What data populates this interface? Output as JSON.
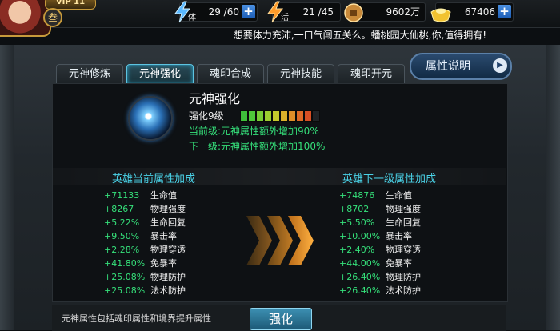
{
  "topbar": {
    "vip_label": "VIP 11",
    "rank_badge": "叁",
    "stamina": {
      "icon": "lightning-icon",
      "label": "体",
      "value": "29 /60"
    },
    "vitality": {
      "icon": "lightning-icon",
      "label": "活",
      "value": "21 /45"
    },
    "coins": {
      "icon": "coin-icon",
      "value": "9602万"
    },
    "gold": {
      "icon": "gold-ingot-icon",
      "value": "67406"
    }
  },
  "notice": "想要体力充沛,一口气闯五关么。蟠桃园大仙桃,你,值得拥有!",
  "tabs": [
    {
      "label": "元神修炼"
    },
    {
      "label": "元神强化",
      "active": true
    },
    {
      "label": "魂印合成"
    },
    {
      "label": "元神技能"
    },
    {
      "label": "魂印开元"
    }
  ],
  "info_button": "属性说明",
  "skill": {
    "title": "元神强化",
    "level_label": "强化9级",
    "level_current": 9,
    "level_max": 10,
    "current_bonus": "当前级:元神属性额外增加90%",
    "next_bonus": "下一级:元神属性额外增加100%"
  },
  "current_header": "英雄当前属性加成",
  "next_header": "英雄下一级属性加成",
  "current_attrs": [
    {
      "value": "+71133",
      "name": "生命值"
    },
    {
      "value": "+8267",
      "name": "物理强度"
    },
    {
      "value": "+5.22%",
      "name": "生命回复"
    },
    {
      "value": "+9.50%",
      "name": "暴击率"
    },
    {
      "value": "+2.28%",
      "name": "物理穿透"
    },
    {
      "value": "+41.80%",
      "name": "免暴率"
    },
    {
      "value": "+25.08%",
      "name": "物理防护"
    },
    {
      "value": "+25.08%",
      "name": "法术防护"
    }
  ],
  "next_attrs": [
    {
      "value": "+74876",
      "name": "生命值"
    },
    {
      "value": "+8702",
      "name": "物理强度"
    },
    {
      "value": "+5.50%",
      "name": "生命回复"
    },
    {
      "value": "+10.00%",
      "name": "暴击率"
    },
    {
      "value": "+2.40%",
      "name": "物理穿透"
    },
    {
      "value": "+44.00%",
      "name": "免暴率"
    },
    {
      "value": "+26.40%",
      "name": "物理防护"
    },
    {
      "value": "+26.40%",
      "name": "法术防护"
    }
  ],
  "bottom_note": "元神属性包括魂印属性和境界提升属性",
  "strengthen_button": "强化",
  "colors": {
    "accent_cyan": "#4ad1e6",
    "bonus_green": "#35e07a",
    "tab_active_border": "#5ec3e0"
  }
}
